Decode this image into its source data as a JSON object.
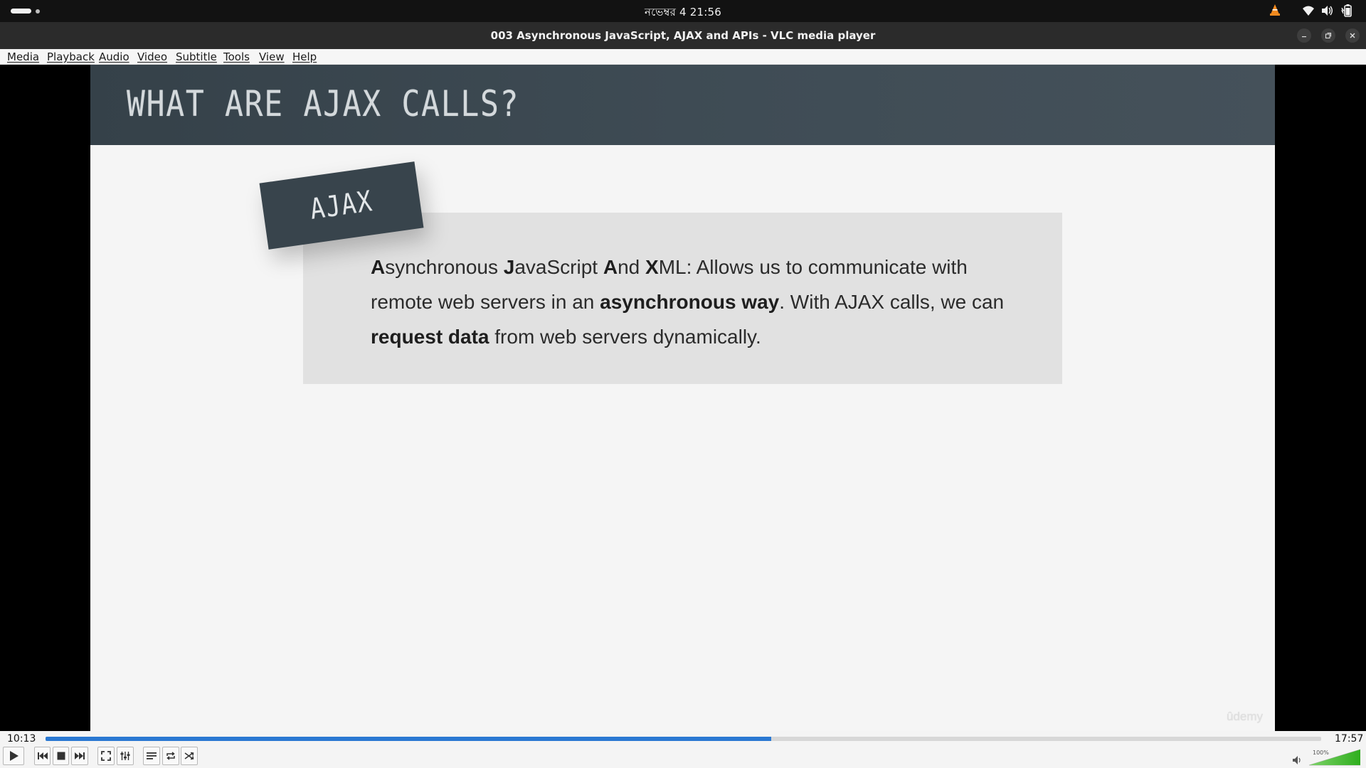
{
  "system_bar": {
    "clock": "নভেম্বর 4  21:56",
    "icons": [
      "activities-indicator",
      "vlc-tray-icon",
      "wifi-icon",
      "volume-icon",
      "battery-icon"
    ]
  },
  "window": {
    "title": "003 Asynchronous JavaScript, AJAX and APIs - VLC media player",
    "buttons": [
      "minimize-icon",
      "maximize-icon",
      "close-icon"
    ]
  },
  "menu": {
    "items": [
      {
        "label": "Media"
      },
      {
        "label": "Playback"
      },
      {
        "label": "Audio"
      },
      {
        "label": "Video"
      },
      {
        "label": "Subtitle"
      },
      {
        "label": "Tools"
      },
      {
        "label": "View"
      },
      {
        "label": "Help"
      }
    ]
  },
  "slide": {
    "title": "WHAT ARE AJAX CALLS?",
    "tag": "AJAX",
    "definition": {
      "p1_a": "A",
      "p1_b": "synchronous ",
      "p2_a": "J",
      "p2_b": "avaScript ",
      "p3_a": "A",
      "p3_b": "nd ",
      "p4_a": "X",
      "p4_b": "ML: Allows us to communicate with remote web servers in an ",
      "p5_bold": "asynchronous way",
      "p6": ". With AJAX calls, we can ",
      "p7_bold": "request data",
      "p8": " from web servers dynamically."
    },
    "watermark": "ûdemy",
    "colors": {
      "header": "#3f4c55",
      "box": "#e1e1e1",
      "tag": "#38444c",
      "background": "#f5f5f5"
    }
  },
  "playback": {
    "elapsed": "10:13",
    "total": "17:57",
    "progress_fraction": 0.569,
    "volume_label": "100%",
    "volume_fraction": 1.0,
    "accent": "#2a78d2"
  },
  "controls": {
    "icons": [
      "play-icon",
      "previous-icon",
      "stop-icon",
      "next-icon",
      "fullscreen-icon",
      "extended-settings-icon",
      "playlist-icon",
      "loop-icon",
      "random-icon",
      "speaker-icon"
    ]
  }
}
